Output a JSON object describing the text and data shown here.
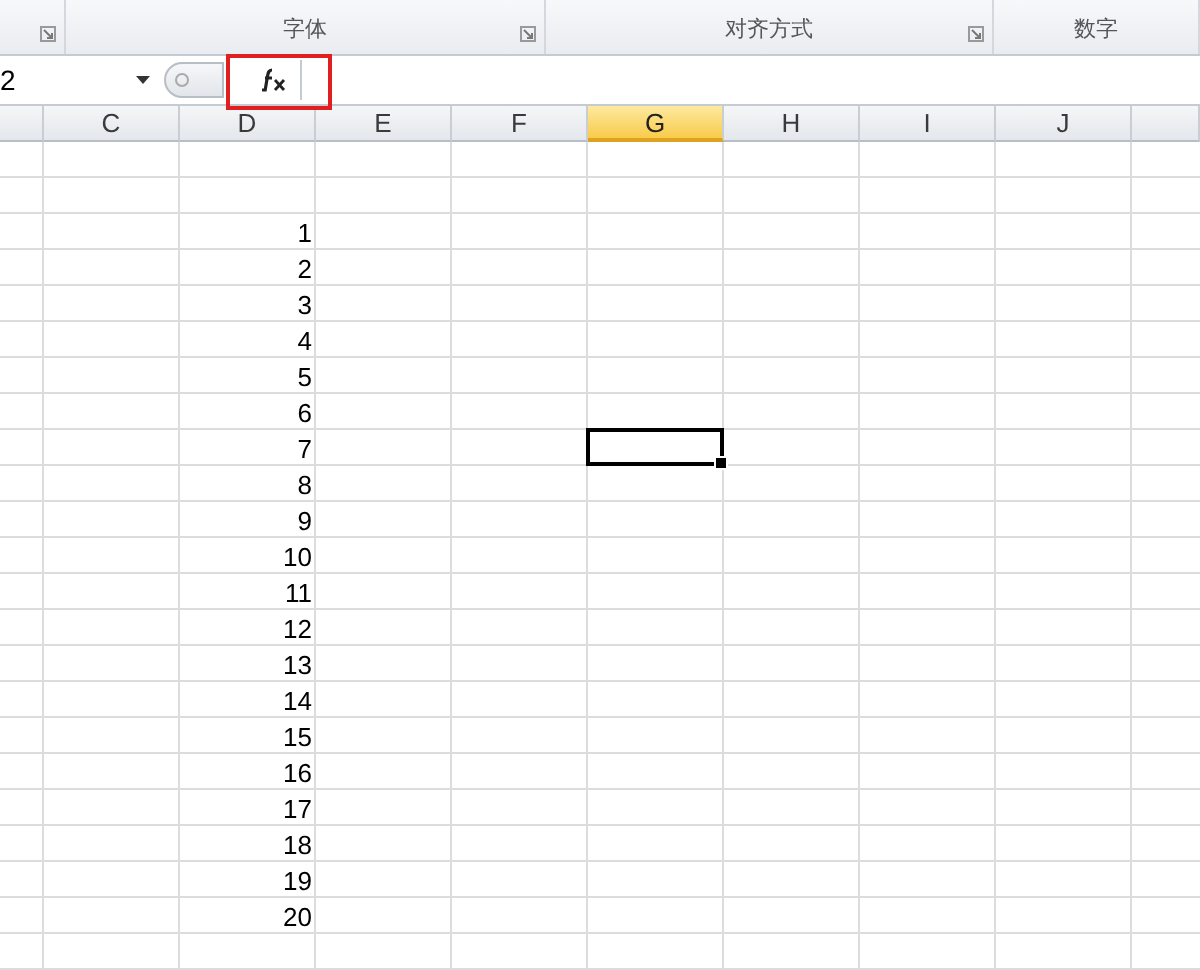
{
  "ribbon": {
    "partial_group": {
      "launcher": true
    },
    "groups": [
      {
        "label": "字体",
        "launcher": true
      },
      {
        "label": "对齐方式",
        "launcher": true
      },
      {
        "label": "数字",
        "launcher": false
      }
    ]
  },
  "formula_bar": {
    "name_box": "2",
    "fx_highlighted": true
  },
  "columns": [
    {
      "label": "C",
      "selected": false
    },
    {
      "label": "D",
      "selected": false
    },
    {
      "label": "E",
      "selected": false
    },
    {
      "label": "F",
      "selected": false
    },
    {
      "label": "G",
      "selected": true
    },
    {
      "label": "H",
      "selected": false
    },
    {
      "label": "I",
      "selected": false
    },
    {
      "label": "J",
      "selected": false
    }
  ],
  "rows": [
    {
      "selected": false
    },
    {
      "selected": false
    },
    {
      "column_d": "1",
      "selected": false
    },
    {
      "column_d": "2",
      "selected": false
    },
    {
      "column_d": "3",
      "selected": false
    },
    {
      "column_d": "4",
      "selected": false
    },
    {
      "column_d": "5",
      "selected": false
    },
    {
      "column_d": "6",
      "selected": false
    },
    {
      "column_d": "7",
      "selected": true
    },
    {
      "column_d": "8",
      "selected": false
    },
    {
      "column_d": "9",
      "selected": false
    },
    {
      "column_d": "10",
      "selected": false
    },
    {
      "column_d": "11",
      "selected": false
    },
    {
      "column_d": "12",
      "selected": false
    },
    {
      "column_d": "13",
      "selected": false
    },
    {
      "column_d": "14",
      "selected": false
    },
    {
      "column_d": "15",
      "selected": false
    },
    {
      "column_d": "16",
      "selected": false
    },
    {
      "column_d": "17",
      "selected": false
    },
    {
      "column_d": "18",
      "selected": false
    },
    {
      "column_d": "19",
      "selected": false
    },
    {
      "column_d": "20",
      "selected": false
    },
    {
      "selected": false
    }
  ]
}
